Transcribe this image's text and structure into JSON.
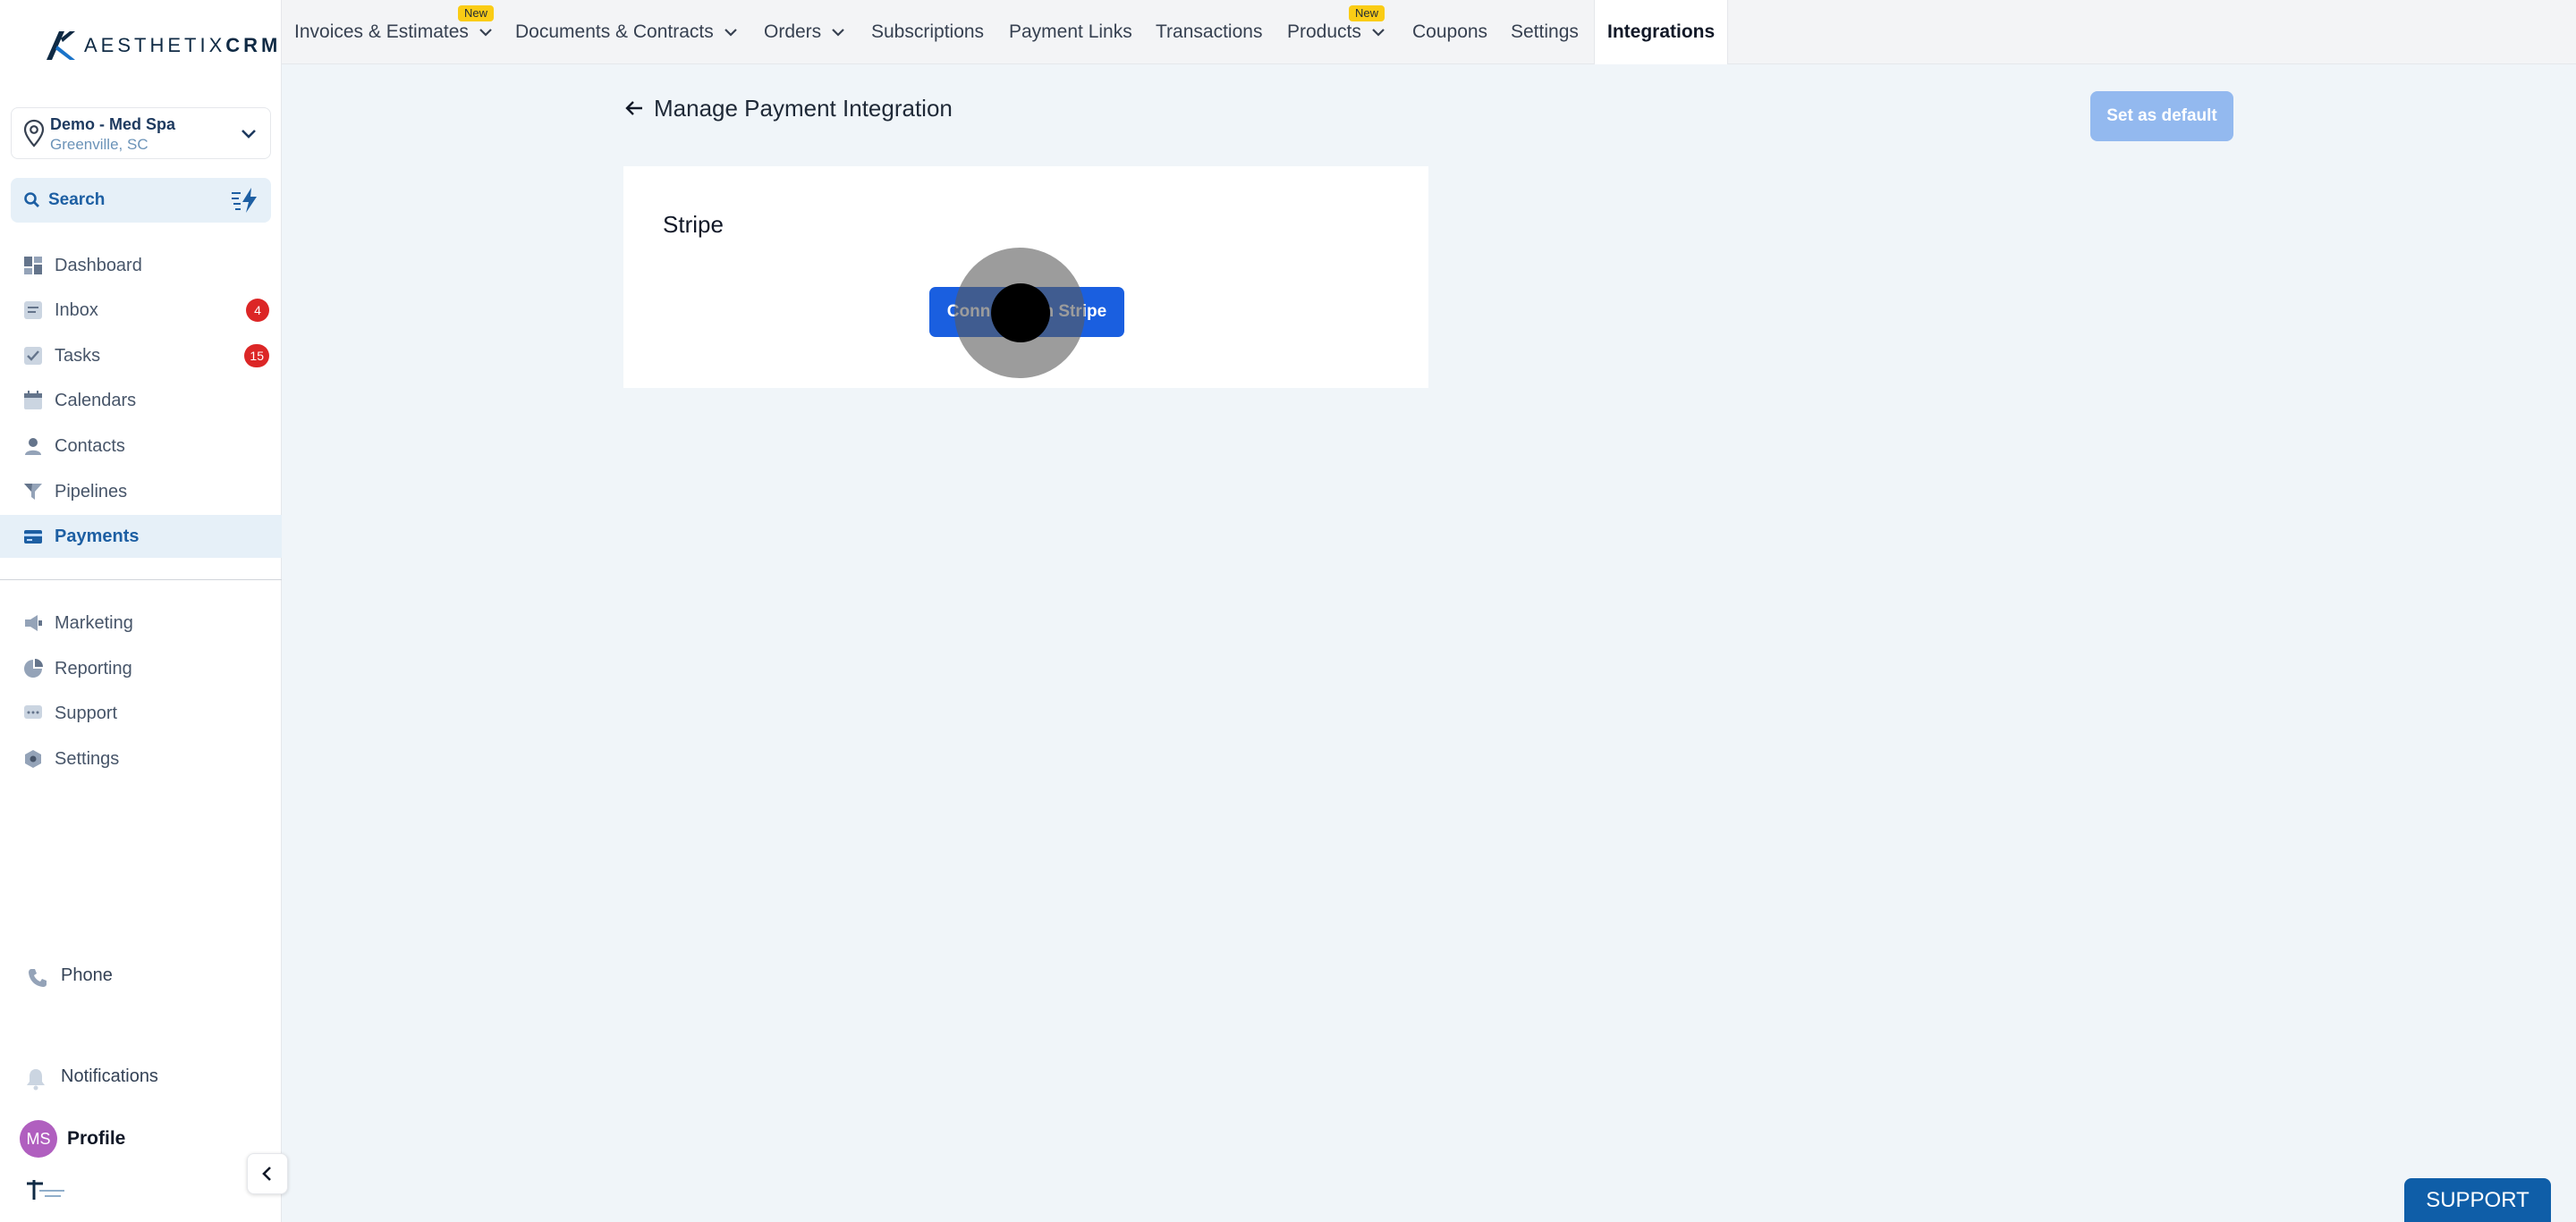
{
  "brand": {
    "logo_text_light": "AESTHETIX",
    "logo_text_bold": "CRM",
    "accent": "#1a5fe0"
  },
  "location": {
    "name": "Demo - Med Spa",
    "city": "Greenville, SC"
  },
  "search": {
    "label": "Search"
  },
  "sidebar": {
    "items": [
      {
        "label": "Dashboard",
        "icon": "dashboard-icon"
      },
      {
        "label": "Inbox",
        "icon": "inbox-icon",
        "badge": "4"
      },
      {
        "label": "Tasks",
        "icon": "tasks-icon",
        "badge": "15"
      },
      {
        "label": "Calendars",
        "icon": "calendar-icon"
      },
      {
        "label": "Contacts",
        "icon": "contacts-icon"
      },
      {
        "label": "Pipelines",
        "icon": "pipelines-icon"
      },
      {
        "label": "Payments",
        "icon": "payments-icon",
        "active": true
      }
    ],
    "secondary": [
      {
        "label": "Marketing",
        "icon": "marketing-icon"
      },
      {
        "label": "Reporting",
        "icon": "reporting-icon"
      },
      {
        "label": "Support",
        "icon": "support-icon"
      },
      {
        "label": "Settings",
        "icon": "settings-icon"
      }
    ],
    "phone": "Phone",
    "notifications": "Notifications",
    "profile": {
      "initials": "MS",
      "label": "Profile"
    }
  },
  "topnav": {
    "tabs": [
      {
        "label": "Invoices & Estimates",
        "new": "New",
        "caret": true
      },
      {
        "label": "Documents & Contracts",
        "caret": true
      },
      {
        "label": "Orders",
        "caret": true
      },
      {
        "label": "Subscriptions"
      },
      {
        "label": "Payment Links"
      },
      {
        "label": "Transactions"
      },
      {
        "label": "Products",
        "new": "New",
        "caret": true
      },
      {
        "label": "Coupons"
      },
      {
        "label": "Settings"
      },
      {
        "label": "Integrations",
        "active": true
      }
    ]
  },
  "main": {
    "title": "Manage Payment Integration",
    "default_button": "Set as default",
    "card_title": "Stripe",
    "connect_button": "Connect with Stripe"
  },
  "support_button": "SUPPORT"
}
